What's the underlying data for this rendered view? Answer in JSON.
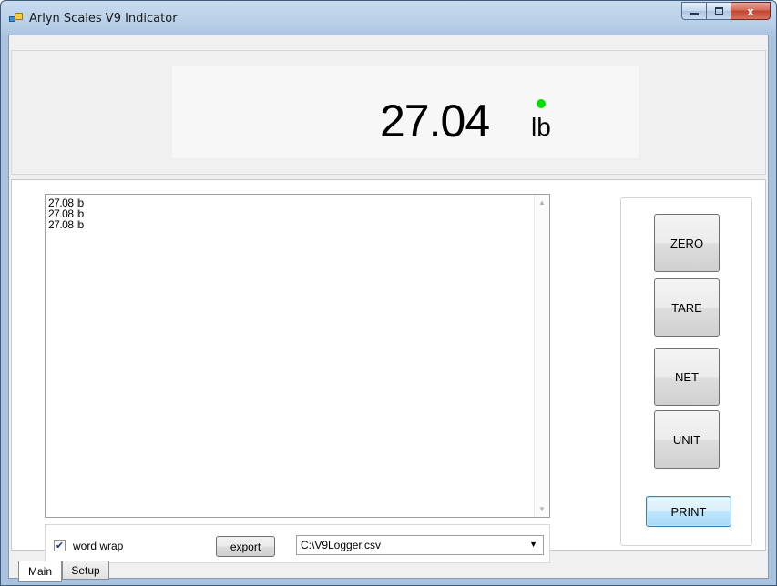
{
  "window": {
    "title": "Arlyn Scales V9 Indicator",
    "caption": {
      "minimize": "minimize",
      "maximize": "maximize",
      "close": "x"
    }
  },
  "display": {
    "weight": "27.04",
    "unit": "lb",
    "stable_indicator_color": "#00e000"
  },
  "log": {
    "lines": [
      "27.08 lb",
      "27.08 lb",
      "27.08 lb"
    ]
  },
  "controls": {
    "word_wrap_label": "word wrap",
    "word_wrap_checked": true,
    "export_label": "export",
    "file_path": "C:\\V9Logger.csv"
  },
  "buttons": {
    "zero": "ZERO",
    "tare": "TARE",
    "net": "NET",
    "unit": "UNIT",
    "print": "PRINT"
  },
  "tabs": [
    {
      "label": "Main",
      "active": true
    },
    {
      "label": "Setup",
      "active": false
    }
  ],
  "icons": {
    "app": "app-icon",
    "check": "checkmark-icon",
    "dropdown": "chevron-down-icon",
    "scroll_up": "scroll-up-icon",
    "scroll_down": "scroll-down-icon"
  }
}
